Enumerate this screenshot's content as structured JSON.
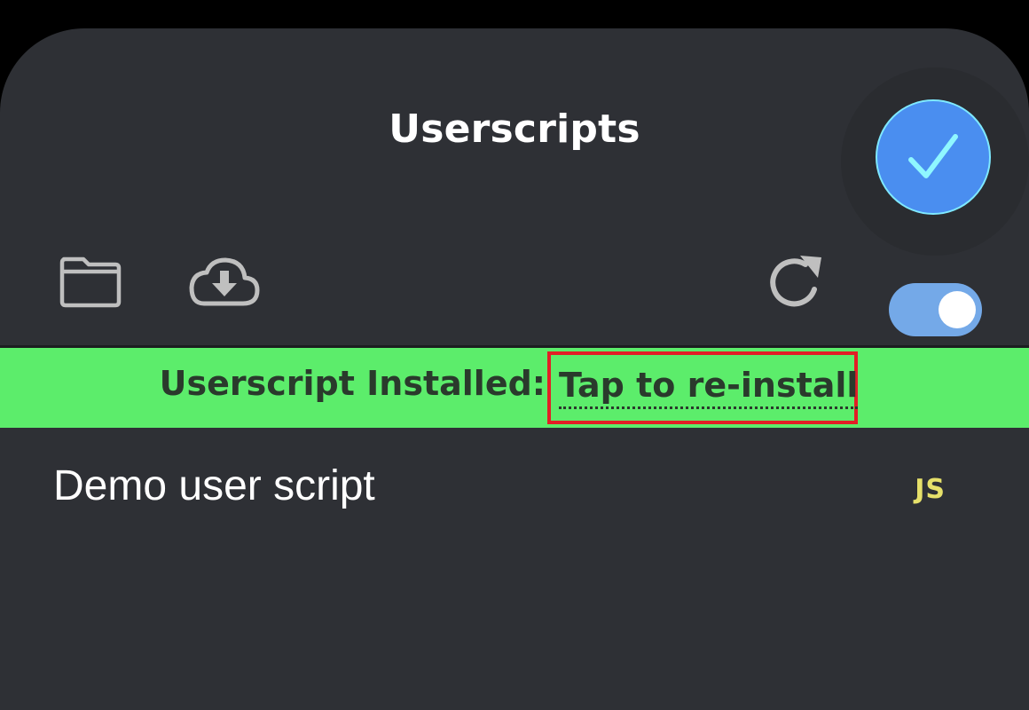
{
  "header": {
    "title": "Userscripts"
  },
  "toolbar": {
    "icons": {
      "folder": "folder-icon",
      "cloud_download": "cloud-download-icon",
      "refresh": "refresh-icon",
      "done": "checkmark-icon"
    },
    "toggle_enabled": true
  },
  "banner": {
    "status_text": "Userscript Installed:",
    "action_text": "Tap to re-install",
    "background_color": "#5ced6b",
    "highlight_color": "#e21f26"
  },
  "scripts": [
    {
      "name": "Demo user script",
      "type": "JS"
    }
  ],
  "colors": {
    "panel_background": "#2e3035",
    "accent_blue": "#4a8ef0",
    "toggle_on": "#74a9e8",
    "js_badge": "#e6e06a"
  }
}
